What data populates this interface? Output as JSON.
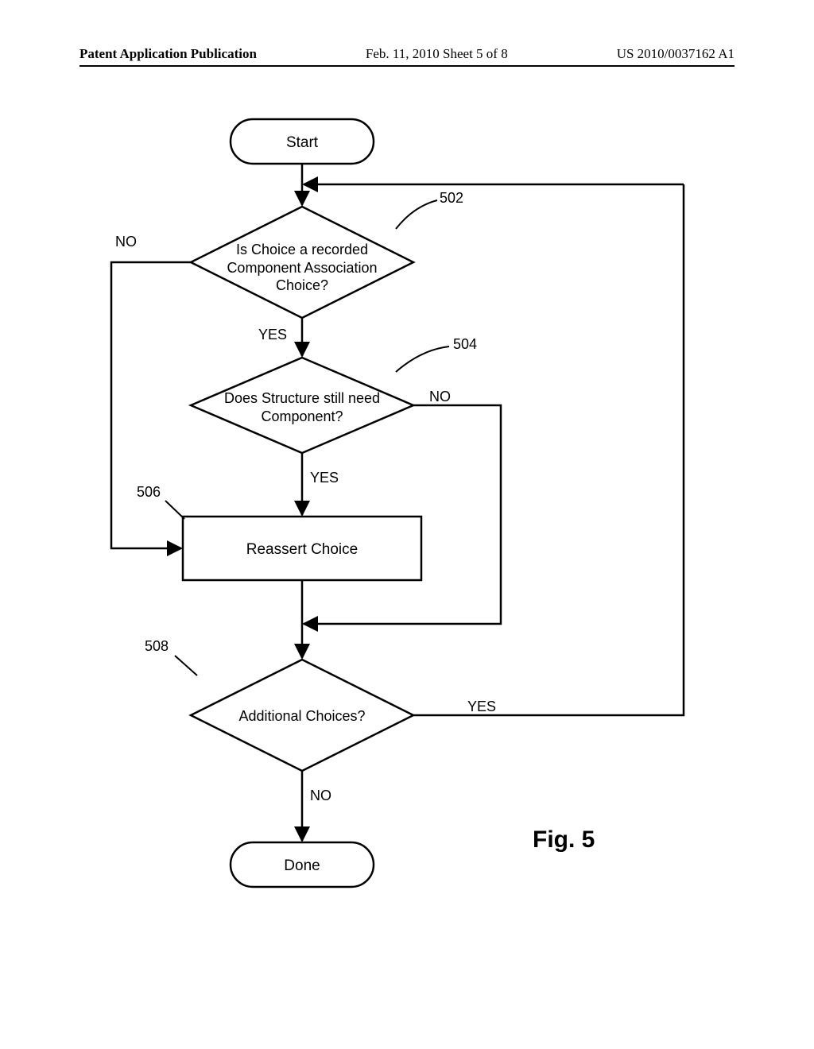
{
  "header": {
    "left": "Patent Application Publication",
    "center": "Feb. 11, 2010  Sheet 5 of 8",
    "right": "US 2010/0037162 A1"
  },
  "figure_label": "Fig. 5",
  "nodes": {
    "start": "Start",
    "d502": "Is Choice a recorded\nComponent Association\nChoice?",
    "d504": "Does Structure still need\nComponent?",
    "p506": "Reassert Choice",
    "d508": "Additional Choices?",
    "done": "Done"
  },
  "edge_labels": {
    "d502_no": "NO",
    "d502_yes": "YES",
    "d504_no": "NO",
    "d504_yes": "YES",
    "d508_yes": "YES",
    "d508_no": "NO"
  },
  "refs": {
    "r502": "502",
    "r504": "504",
    "r506": "506",
    "r508": "508"
  }
}
